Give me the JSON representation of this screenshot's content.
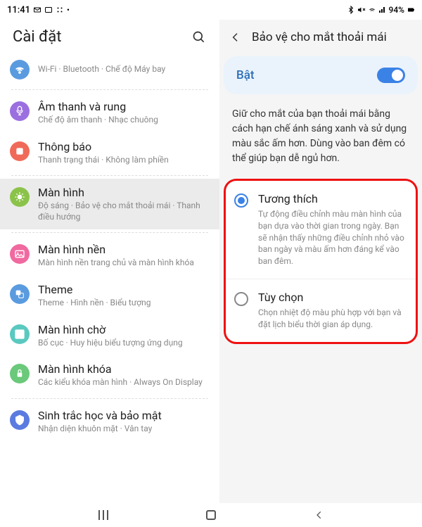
{
  "status": {
    "time": "11:41",
    "battery": "94%"
  },
  "left": {
    "title": "Cài đặt",
    "conn_sub": "Wi-Fi · Bluetooth · Chế độ Máy bay",
    "items": [
      {
        "title": "Âm thanh và rung",
        "sub": "Chế độ âm thanh · Nhạc chuông",
        "color": "#9b6fe0"
      },
      {
        "title": "Thông báo",
        "sub": "Thanh trạng thái · Không làm phiền",
        "color": "#f06a5a"
      },
      {
        "title": "Màn hình",
        "sub": "Độ sáng · Bảo vệ cho mắt thoải mái · Thanh điều hướng",
        "color": "#8bc34a",
        "active": true
      },
      {
        "title": "Màn hình nền",
        "sub": "Màn hình nền trang chủ và màn hình khóa",
        "color": "#f06aa0"
      },
      {
        "title": "Theme",
        "sub": "Theme · Hình nền · Biểu tượng",
        "color": "#5a9be0"
      },
      {
        "title": "Màn hình chờ",
        "sub": "Bố cục · Huy hiệu biểu tượng ứng dụng",
        "color": "#5ac9c0"
      },
      {
        "title": "Màn hình khóa",
        "sub": "Các kiểu khóa màn hình · Always On Display",
        "color": "#6ac97a"
      },
      {
        "title": "Sinh trắc học và bảo mật",
        "sub": "Nhận diện khuôn mặt · Vân tay",
        "color": "#5a7be0"
      }
    ]
  },
  "right": {
    "title": "Bảo vệ cho mắt thoải mái",
    "toggle_label": "Bật",
    "description": "Giữ cho mắt của bạn thoải mái bằng cách hạn chế ánh sáng xanh và sử dụng màu sắc ấm hơn. Dùng vào ban đêm có thể giúp bạn dễ ngủ hơn.",
    "options": [
      {
        "title": "Tương thích",
        "desc": "Tự động điều chỉnh màu màn hình của bạn dựa vào thời gian trong ngày. Bạn sẽ nhận thấy những điều chỉnh nhỏ vào ban ngày và màu ấm hơn đáng kể vào ban đêm.",
        "checked": true
      },
      {
        "title": "Tùy chọn",
        "desc": "Chọn nhiệt độ màu phù hợp với bạn và đặt lịch biểu thời gian áp dụng.",
        "checked": false
      }
    ]
  }
}
